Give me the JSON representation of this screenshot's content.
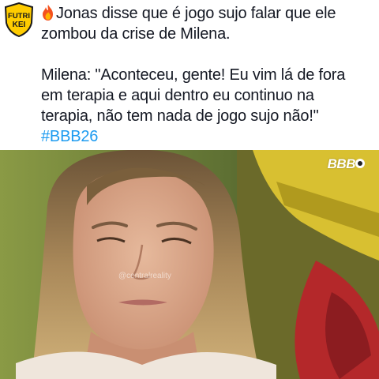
{
  "logo": {
    "line1": "FUTRI",
    "line2": "KEI",
    "icon": "futrikei-logo",
    "color": "#ffcc00"
  },
  "tweet": {
    "line1": "Jonas disse que é jogo sujo falar que ele",
    "line2": "zombou da crise de Milena.",
    "quote_line1": "Milena: \"Aconteceu, gente! Eu vim lá de fora",
    "quote_line2": "em terapia e aqui dentro eu continuo na",
    "quote_line3": "terapia, não tem nada de jogo sujo não!\"",
    "hashtag": "#BBB26",
    "emoji_icon": "fire-icon",
    "hashtag_color": "#1d9bf0"
  },
  "photo": {
    "badge": "BBB",
    "watermark": "@centralreality"
  }
}
